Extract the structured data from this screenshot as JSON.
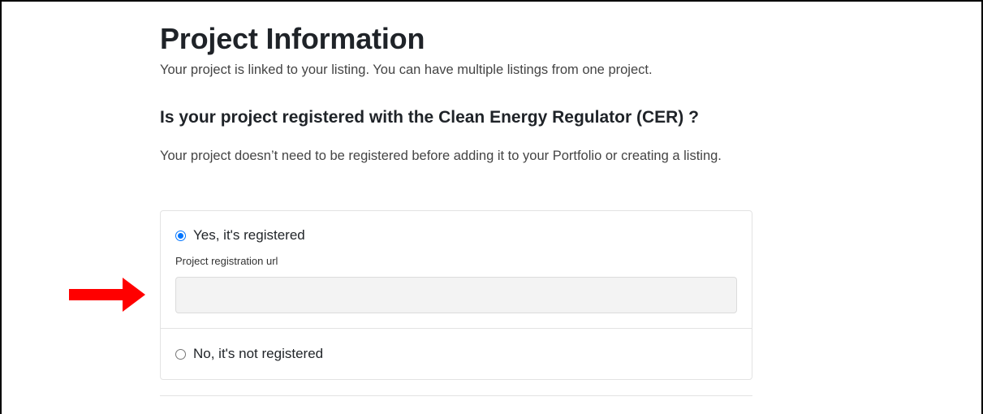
{
  "header": {
    "title": "Project Information",
    "subtitle": "Your project is linked to your listing. You can have multiple listings from one project."
  },
  "question": {
    "text": "Is your project registered with the Clean Energy Regulator (CER) ?",
    "help": "Your project doesn’t need to be registered before adding it to your Portfolio or creating a listing."
  },
  "options": {
    "yes_label": "Yes, it's registered",
    "no_label": "No, it's not registered",
    "selected": "yes"
  },
  "registration_url": {
    "label": "Project registration url",
    "value": "",
    "placeholder": ""
  },
  "colors": {
    "accent": "#0075ff",
    "arrow": "#ff0000"
  },
  "icons": {
    "annotation": "right-arrow-icon"
  }
}
